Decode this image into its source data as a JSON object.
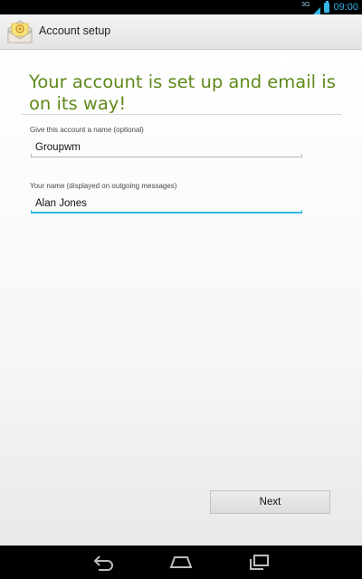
{
  "status_bar": {
    "network": "3G",
    "time": "09:00",
    "accent": "#33b5e5"
  },
  "action_bar": {
    "title": "Account setup",
    "icon": "email-icon"
  },
  "main": {
    "headline": "Your account is set up and email is on its way!",
    "headline_color": "#5f8a1b",
    "account_name": {
      "label": "Give this account a name (optional)",
      "value": "Groupwm"
    },
    "your_name": {
      "label": "Your name (displayed on outgoing messages)",
      "value": "Alan Jones"
    },
    "next_label": "Next"
  },
  "nav_bar": {
    "icons": [
      "back-icon",
      "home-icon",
      "recent-apps-icon"
    ]
  }
}
